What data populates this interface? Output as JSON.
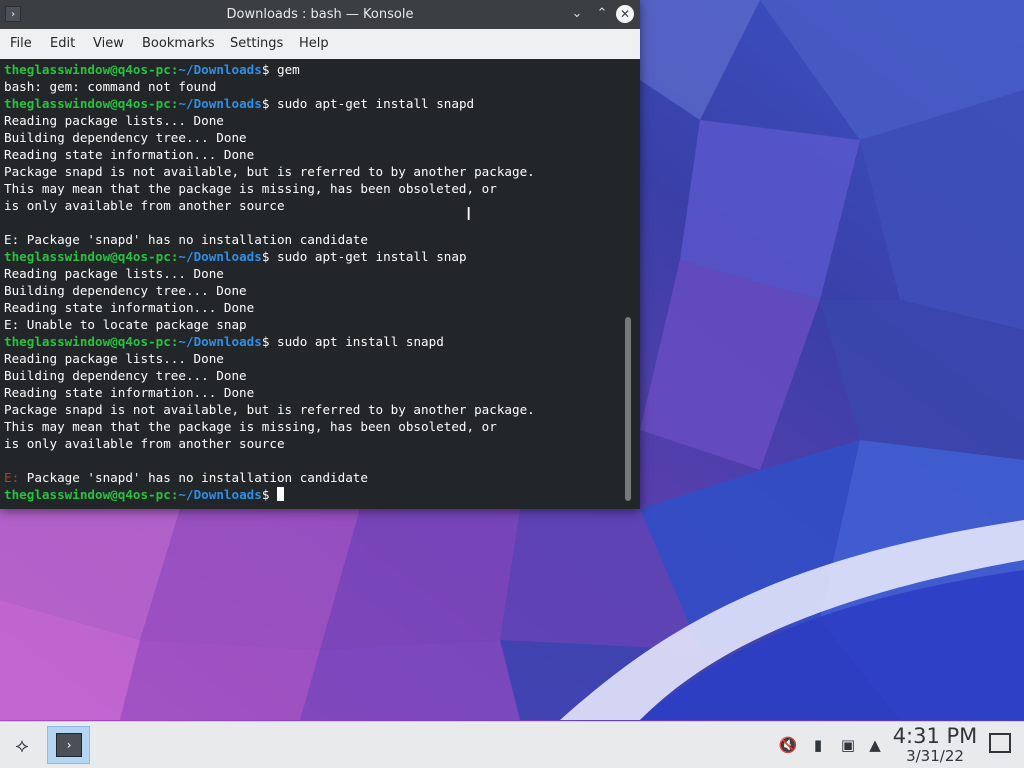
{
  "window": {
    "title": "Downloads : bash — Konsole",
    "app_icon": "terminal-icon",
    "buttons": {
      "minimize": "chevron-down-icon",
      "maximize": "chevron-up-icon",
      "close": "close-icon"
    }
  },
  "menu": [
    "File",
    "Edit",
    "View",
    "Bookmarks",
    "Settings",
    "Help"
  ],
  "terminal": {
    "lines": [
      {
        "type": "prompt",
        "user": "theglasswindow@q4os-pc",
        "path": "~/Downloads",
        "cmd": "gem"
      },
      {
        "type": "text",
        "text": "bash: gem: command not found"
      },
      {
        "type": "prompt",
        "user": "theglasswindow@q4os-pc",
        "path": "~/Downloads",
        "cmd": "sudo apt-get install snapd"
      },
      {
        "type": "text",
        "text": "Reading package lists... Done"
      },
      {
        "type": "text",
        "text": "Building dependency tree... Done"
      },
      {
        "type": "text",
        "text": "Reading state information... Done"
      },
      {
        "type": "text",
        "text": "Package snapd is not available, but is referred to by another package."
      },
      {
        "type": "text",
        "text": "This may mean that the package is missing, has been obsoleted, or"
      },
      {
        "type": "text",
        "text": "is only available from another source"
      },
      {
        "type": "text",
        "text": ""
      },
      {
        "type": "text",
        "text": "E: Package 'snapd' has no installation candidate"
      },
      {
        "type": "prompt",
        "user": "theglasswindow@q4os-pc",
        "path": "~/Downloads",
        "cmd": "sudo apt-get install snap"
      },
      {
        "type": "text",
        "text": "Reading package lists... Done"
      },
      {
        "type": "text",
        "text": "Building dependency tree... Done"
      },
      {
        "type": "text",
        "text": "Reading state information... Done"
      },
      {
        "type": "text",
        "text": "E: Unable to locate package snap"
      },
      {
        "type": "prompt",
        "user": "theglasswindow@q4os-pc",
        "path": "~/Downloads",
        "cmd": "sudo apt install snapd"
      },
      {
        "type": "text",
        "text": "Reading package lists... Done"
      },
      {
        "type": "text",
        "text": "Building dependency tree... Done"
      },
      {
        "type": "text",
        "text": "Reading state information... Done"
      },
      {
        "type": "text",
        "text": "Package snapd is not available, but is referred to by another package."
      },
      {
        "type": "text",
        "text": "This may mean that the package is missing, has been obsoleted, or"
      },
      {
        "type": "text",
        "text": "is only available from another source"
      },
      {
        "type": "text",
        "text": ""
      },
      {
        "type": "error",
        "prefix": "E:",
        "text": " Package 'snapd' has no installation candidate"
      },
      {
        "type": "prompt",
        "user": "theglasswindow@q4os-pc",
        "path": "~/Downloads",
        "cmd": "",
        "cursor": true
      }
    ],
    "prompt_colon": ":",
    "prompt_dollar": "$ "
  },
  "taskbar": {
    "launcher_icon": "app-launcher-icon",
    "task": "konsole-task-button",
    "tray_icons": [
      "volume-muted-icon",
      "usb-device-icon",
      "network-icon",
      "expand-tray-icon"
    ],
    "clock": {
      "time": "4:31 PM",
      "date": "3/31/22"
    },
    "show_desktop_icon": "show-desktop-icon"
  },
  "colors": {
    "prompt_user": "#27c23f",
    "prompt_path": "#2f8fe6",
    "error": "#c0392b",
    "terminal_bg": "#232629"
  }
}
